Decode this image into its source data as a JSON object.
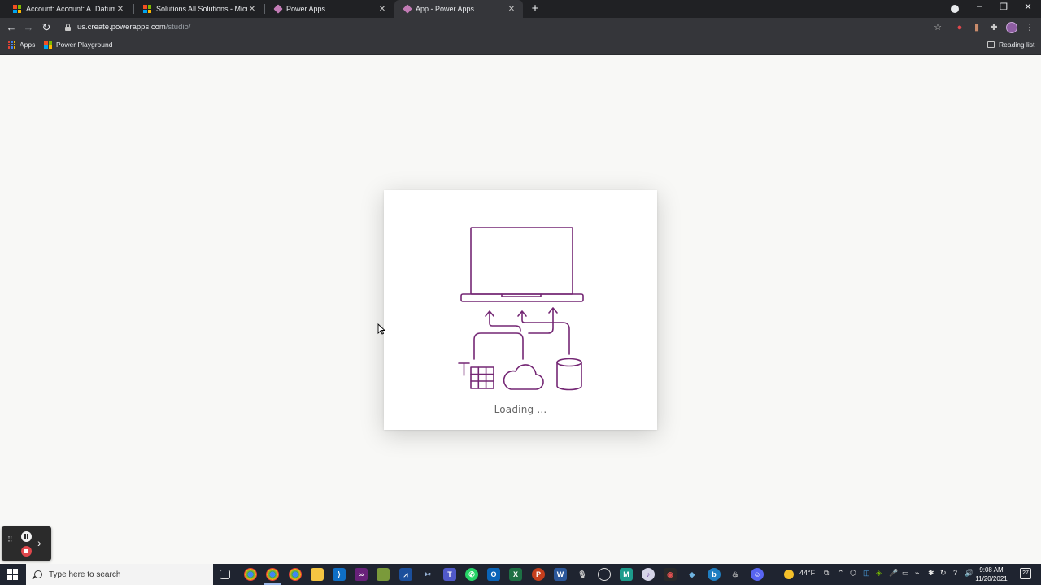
{
  "browser": {
    "tabs": [
      {
        "title": "Account: Account: A. Datum Corp",
        "icon": "microsoft-icon",
        "active": false
      },
      {
        "title": "Solutions All Solutions - Microsoft",
        "icon": "microsoft-icon",
        "active": false
      },
      {
        "title": "Power Apps",
        "icon": "power-apps-icon",
        "active": false
      },
      {
        "title": "App - Power Apps",
        "icon": "power-apps-icon",
        "active": true
      }
    ],
    "new_tab_symbol": "+",
    "address": {
      "host": "us.create.powerapps.com",
      "path": "/studio/"
    },
    "bookmarks": [
      {
        "label": "Apps",
        "icon": "apps-grid-icon"
      },
      {
        "label": "Power Playground",
        "icon": "microsoft-icon"
      }
    ],
    "reading_list_label": "Reading list"
  },
  "page": {
    "loading_text": "Loading ...",
    "illustration_color": "#742774"
  },
  "taskbar": {
    "search_placeholder": "Type here to search",
    "weather": "44°F",
    "time": "9:08 AM",
    "date": "11/20/2021",
    "notification_count": "27"
  },
  "colors": {
    "chrome_dark": "#202124",
    "chrome_toolbar": "#35363a",
    "page_background": "#f8f8f6",
    "accent_purple": "#742774",
    "taskbar": "#1f2430"
  }
}
